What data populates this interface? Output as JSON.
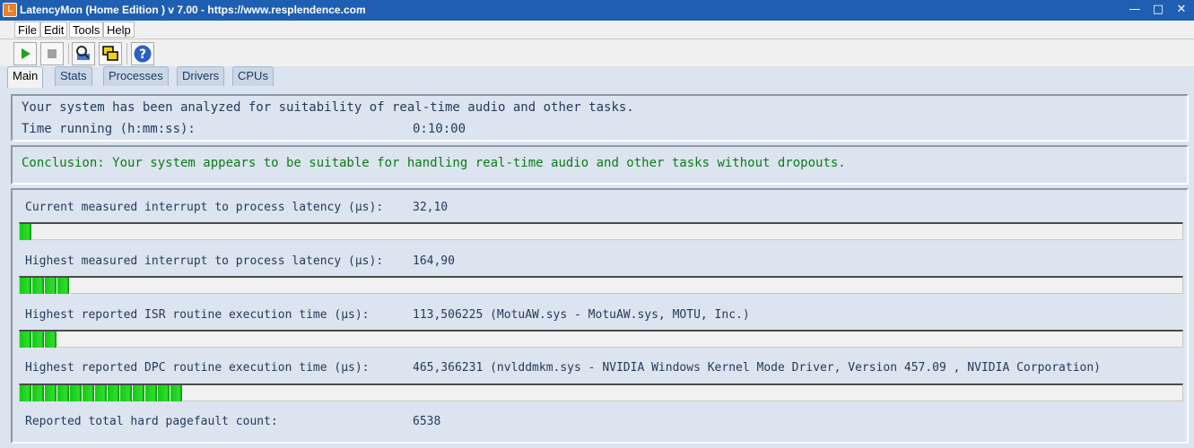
{
  "window": {
    "title": "LatencyMon  (Home Edition )  v 7.00 - https://www.resplendence.com",
    "minimize_label": "—",
    "maximize_label": "□",
    "close_label": "✕"
  },
  "menu": {
    "items": [
      {
        "label": "File"
      },
      {
        "label": "Edit"
      },
      {
        "label": "Tools"
      },
      {
        "label": "Help"
      }
    ]
  },
  "toolbar": {
    "buttons": [
      {
        "icon": "play-icon"
      },
      {
        "icon": "stop-icon"
      },
      {
        "icon": "magnifier-tool-icon"
      },
      {
        "icon": "windows-icon"
      },
      {
        "icon": "help-icon"
      }
    ]
  },
  "tabs": [
    {
      "label": "Main",
      "active": true
    },
    {
      "label": "Stats",
      "active": false
    },
    {
      "label": "Processes",
      "active": false
    },
    {
      "label": "Drivers",
      "active": false
    },
    {
      "label": "CPUs",
      "active": false
    }
  ],
  "summary": {
    "analysis_text": "Your system has been analyzed for suitability of real-time audio and other tasks.",
    "time_label": "Time running (h:mm:ss):",
    "time_value": "0:10:00"
  },
  "conclusion": {
    "text": "Conclusion: Your system appears to be suitable for handling real-time audio and other tasks without dropouts."
  },
  "metrics": [
    {
      "label": "Current measured interrupt to process latency (µs):",
      "value": "32,10",
      "fill_fraction": 0.01
    },
    {
      "label": "Highest measured interrupt to process latency (µs):",
      "value": "164,90",
      "fill_fraction": 0.045
    },
    {
      "label": "Highest reported ISR routine execution time (µs):",
      "value": "113,506225  (MotuAW.sys - MotuAW.sys, MOTU, Inc.)",
      "fill_fraction": 0.034
    },
    {
      "label": "Highest reported DPC routine execution time (µs):",
      "value": "465,366231  (nvlddmkm.sys - NVIDIA Windows Kernel Mode Driver, Version 457.09 , NVIDIA Corporation)",
      "fill_fraction": 0.137
    },
    {
      "label": "Reported total hard pagefault count:",
      "value": "6538"
    }
  ],
  "colors": {
    "titlebar": "#1e5fb2",
    "conclusion_text": "#0b7d16",
    "bar_fill": "#16c816"
  }
}
